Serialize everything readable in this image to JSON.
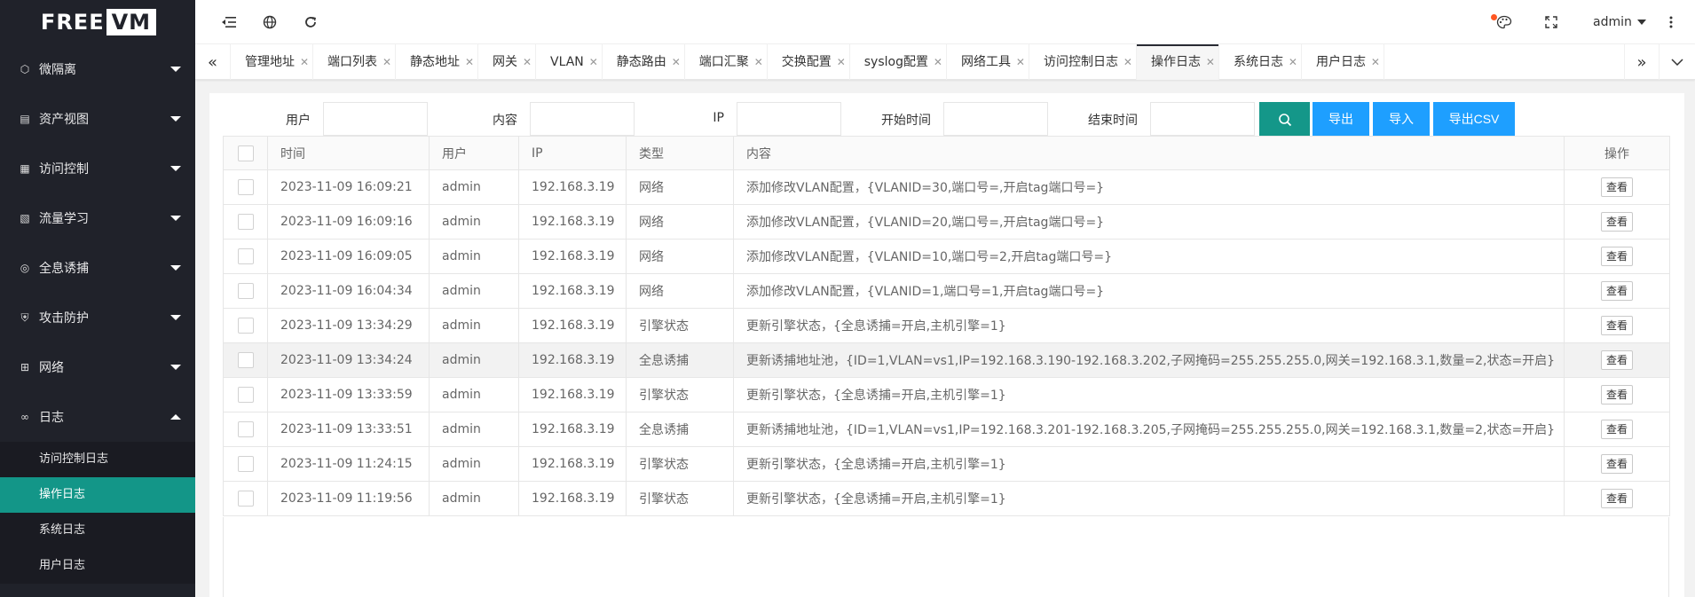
{
  "logo": {
    "part1": "FREE",
    "part2": "VM"
  },
  "sidebar": {
    "items": [
      {
        "label": "微隔离",
        "icon": "cube-icon",
        "glyph": "⬡"
      },
      {
        "label": "资产视图",
        "icon": "server-icon",
        "glyph": "▤"
      },
      {
        "label": "访问控制",
        "icon": "grid-icon",
        "glyph": "▦"
      },
      {
        "label": "流量学习",
        "icon": "flow-icon",
        "glyph": "▧"
      },
      {
        "label": "全息诱捕",
        "icon": "target-icon",
        "glyph": "◎"
      },
      {
        "label": "攻击防护",
        "icon": "shield-icon",
        "glyph": "⛨"
      },
      {
        "label": "网络",
        "icon": "network-icon",
        "glyph": "⊞"
      },
      {
        "label": "日志",
        "icon": "infinity-icon",
        "glyph": "∞"
      }
    ],
    "submenu": [
      "访问控制日志",
      "操作日志",
      "系统日志",
      "用户日志"
    ]
  },
  "header": {
    "user": "admin"
  },
  "tabs": [
    "管理地址",
    "端口列表",
    "静态地址",
    "网关",
    "VLAN",
    "静态路由",
    "端口汇聚",
    "交换配置",
    "syslog配置",
    "网络工具",
    "访问控制日志",
    "操作日志",
    "系统日志",
    "用户日志"
  ],
  "search": {
    "user_label": "用户",
    "content_label": "内容",
    "ip_label": "IP",
    "start_label": "开始时间",
    "end_label": "结束时间",
    "export": "导出",
    "import": "导入",
    "export_csv": "导出CSV"
  },
  "table": {
    "headers": {
      "time": "时间",
      "user": "用户",
      "ip": "IP",
      "type": "类型",
      "content": "内容",
      "op": "操作"
    },
    "view_label": "查看",
    "rows": [
      {
        "time": "2023-11-09 16:09:21",
        "user": "admin",
        "ip": "192.168.3.19",
        "type": "网络",
        "content": "添加修改VLAN配置，{VLANID=30,端口号=,开启tag端口号=}"
      },
      {
        "time": "2023-11-09 16:09:16",
        "user": "admin",
        "ip": "192.168.3.19",
        "type": "网络",
        "content": "添加修改VLAN配置，{VLANID=20,端口号=,开启tag端口号=}"
      },
      {
        "time": "2023-11-09 16:09:05",
        "user": "admin",
        "ip": "192.168.3.19",
        "type": "网络",
        "content": "添加修改VLAN配置，{VLANID=10,端口号=2,开启tag端口号=}"
      },
      {
        "time": "2023-11-09 16:04:34",
        "user": "admin",
        "ip": "192.168.3.19",
        "type": "网络",
        "content": "添加修改VLAN配置，{VLANID=1,端口号=1,开启tag端口号=}"
      },
      {
        "time": "2023-11-09 13:34:29",
        "user": "admin",
        "ip": "192.168.3.19",
        "type": "引擎状态",
        "content": "更新引擎状态，{全息诱捕=开启,主机引擎=1}"
      },
      {
        "time": "2023-11-09 13:34:24",
        "user": "admin",
        "ip": "192.168.3.19",
        "type": "全息诱捕",
        "content": "更新诱捕地址池，{ID=1,VLAN=vs1,IP=192.168.3.190-192.168.3.202,子网掩码=255.255.255.0,网关=192.168.3.1,数量=2,状态=开启}"
      },
      {
        "time": "2023-11-09 13:33:59",
        "user": "admin",
        "ip": "192.168.3.19",
        "type": "引擎状态",
        "content": "更新引擎状态，{全息诱捕=开启,主机引擎=1}"
      },
      {
        "time": "2023-11-09 13:33:51",
        "user": "admin",
        "ip": "192.168.3.19",
        "type": "全息诱捕",
        "content": "更新诱捕地址池，{ID=1,VLAN=vs1,IP=192.168.3.201-192.168.3.205,子网掩码=255.255.255.0,网关=192.168.3.1,数量=2,状态=开启}"
      },
      {
        "time": "2023-11-09 11:24:15",
        "user": "admin",
        "ip": "192.168.3.19",
        "type": "引擎状态",
        "content": "更新引擎状态，{全息诱捕=开启,主机引擎=1}"
      },
      {
        "time": "2023-11-09 11:19:56",
        "user": "admin",
        "ip": "192.168.3.19",
        "type": "引擎状态",
        "content": "更新引擎状态，{全息诱捕=开启,主机引擎=1}"
      }
    ]
  },
  "colors": {
    "sidebar_bg": "#20222a",
    "active_teal": "#139688",
    "primary_blue": "#1e9fff",
    "notify_dot": "#ff5722"
  }
}
